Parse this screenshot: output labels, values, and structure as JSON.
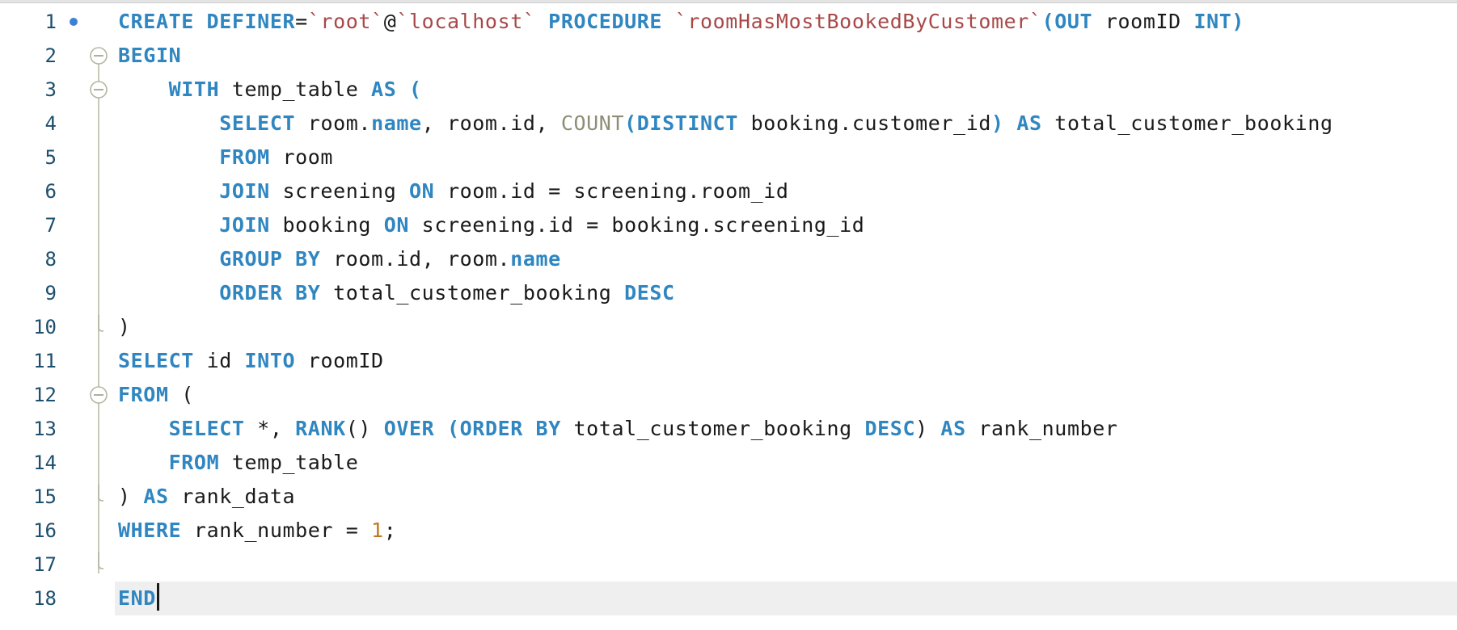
{
  "editor": {
    "language": "sql",
    "caret_line": 18,
    "modified_marker_line": 1,
    "colors": {
      "keyword": "#2f86c0",
      "string": "#a94848",
      "function": "#8e8e76",
      "number": "#c07820",
      "text": "#1a1a1a",
      "gutter": "#1d4f6e",
      "current_line": "#efefef",
      "marker": "#3b82d6"
    },
    "fold_markers": [
      {
        "line": 2,
        "type": "collapse"
      },
      {
        "line": 3,
        "type": "collapse"
      },
      {
        "line": 10,
        "type": "end"
      },
      {
        "line": 12,
        "type": "collapse"
      },
      {
        "line": 15,
        "type": "end"
      },
      {
        "line": 17,
        "type": "end"
      }
    ],
    "lines": [
      {
        "n": "1",
        "tokens": [
          {
            "t": "CREATE DEFINER",
            "c": "kw"
          },
          {
            "t": "=",
            "c": "sym"
          },
          {
            "t": "`root`",
            "c": "str"
          },
          {
            "t": "@",
            "c": "sym"
          },
          {
            "t": "`localhost`",
            "c": "str"
          },
          {
            "t": " PROCEDURE ",
            "c": "kw"
          },
          {
            "t": "`roomHasMostBookedByCustomer`",
            "c": "str"
          },
          {
            "t": "(",
            "c": "kw"
          },
          {
            "t": "OUT",
            "c": "kw"
          },
          {
            "t": " roomID ",
            "c": "plain"
          },
          {
            "t": "INT",
            "c": "kw"
          },
          {
            "t": ")",
            "c": "kw"
          }
        ]
      },
      {
        "n": "2",
        "tokens": [
          {
            "t": "BEGIN",
            "c": "kw"
          }
        ]
      },
      {
        "n": "3",
        "tokens": [
          {
            "t": "    ",
            "c": "plain"
          },
          {
            "t": "WITH",
            "c": "kw"
          },
          {
            "t": " temp_table ",
            "c": "plain"
          },
          {
            "t": "AS",
            "c": "kw"
          },
          {
            "t": " (",
            "c": "kw"
          }
        ]
      },
      {
        "n": "4",
        "tokens": [
          {
            "t": "        ",
            "c": "plain"
          },
          {
            "t": "SELECT",
            "c": "kw"
          },
          {
            "t": " room.",
            "c": "plain"
          },
          {
            "t": "name",
            "c": "prop"
          },
          {
            "t": ", room.id, ",
            "c": "plain"
          },
          {
            "t": "COUNT",
            "c": "fn"
          },
          {
            "t": "(",
            "c": "kw"
          },
          {
            "t": "DISTINCT",
            "c": "kw"
          },
          {
            "t": " booking.customer_id",
            "c": "plain"
          },
          {
            "t": ") ",
            "c": "kw"
          },
          {
            "t": "AS",
            "c": "kw"
          },
          {
            "t": " total_customer_booking",
            "c": "plain"
          }
        ]
      },
      {
        "n": "5",
        "tokens": [
          {
            "t": "        ",
            "c": "plain"
          },
          {
            "t": "FROM",
            "c": "kw"
          },
          {
            "t": " room",
            "c": "plain"
          }
        ]
      },
      {
        "n": "6",
        "tokens": [
          {
            "t": "        ",
            "c": "plain"
          },
          {
            "t": "JOIN",
            "c": "kw"
          },
          {
            "t": " screening ",
            "c": "plain"
          },
          {
            "t": "ON",
            "c": "kw"
          },
          {
            "t": " room.id = screening.room_id",
            "c": "plain"
          }
        ]
      },
      {
        "n": "7",
        "tokens": [
          {
            "t": "        ",
            "c": "plain"
          },
          {
            "t": "JOIN",
            "c": "kw"
          },
          {
            "t": " booking ",
            "c": "plain"
          },
          {
            "t": "ON",
            "c": "kw"
          },
          {
            "t": " screening.id = booking.screening_id",
            "c": "plain"
          }
        ]
      },
      {
        "n": "8",
        "tokens": [
          {
            "t": "        ",
            "c": "plain"
          },
          {
            "t": "GROUP BY",
            "c": "kw"
          },
          {
            "t": " room.id, room.",
            "c": "plain"
          },
          {
            "t": "name",
            "c": "prop"
          }
        ]
      },
      {
        "n": "9",
        "tokens": [
          {
            "t": "        ",
            "c": "plain"
          },
          {
            "t": "ORDER BY",
            "c": "kw"
          },
          {
            "t": " total_customer_booking ",
            "c": "plain"
          },
          {
            "t": "DESC",
            "c": "kw"
          }
        ]
      },
      {
        "n": "10",
        "tokens": [
          {
            "t": ")",
            "c": "plain"
          }
        ]
      },
      {
        "n": "11",
        "tokens": [
          {
            "t": "SELECT",
            "c": "kw"
          },
          {
            "t": " id ",
            "c": "plain"
          },
          {
            "t": "INTO",
            "c": "kw"
          },
          {
            "t": " roomID",
            "c": "plain"
          }
        ]
      },
      {
        "n": "12",
        "tokens": [
          {
            "t": "FROM",
            "c": "kw"
          },
          {
            "t": " (",
            "c": "plain"
          }
        ]
      },
      {
        "n": "13",
        "tokens": [
          {
            "t": "    ",
            "c": "plain"
          },
          {
            "t": "SELECT",
            "c": "kw"
          },
          {
            "t": " *, ",
            "c": "plain"
          },
          {
            "t": "RANK",
            "c": "kw"
          },
          {
            "t": "() ",
            "c": "plain"
          },
          {
            "t": "OVER",
            "c": "kw"
          },
          {
            "t": " (",
            "c": "kw"
          },
          {
            "t": "ORDER BY",
            "c": "kw"
          },
          {
            "t": " total_customer_booking ",
            "c": "plain"
          },
          {
            "t": "DESC",
            "c": "kw"
          },
          {
            "t": ") ",
            "c": "plain"
          },
          {
            "t": "AS",
            "c": "kw"
          },
          {
            "t": " rank_number",
            "c": "plain"
          }
        ]
      },
      {
        "n": "14",
        "tokens": [
          {
            "t": "    ",
            "c": "plain"
          },
          {
            "t": "FROM",
            "c": "kw"
          },
          {
            "t": " temp_table",
            "c": "plain"
          }
        ]
      },
      {
        "n": "15",
        "tokens": [
          {
            "t": ") ",
            "c": "plain"
          },
          {
            "t": "AS",
            "c": "kw"
          },
          {
            "t": " rank_data",
            "c": "plain"
          }
        ]
      },
      {
        "n": "16",
        "tokens": [
          {
            "t": "WHERE",
            "c": "kw"
          },
          {
            "t": " rank_number = ",
            "c": "plain"
          },
          {
            "t": "1",
            "c": "num"
          },
          {
            "t": ";",
            "c": "plain"
          }
        ]
      },
      {
        "n": "17",
        "tokens": []
      },
      {
        "n": "18",
        "tokens": [
          {
            "t": "END",
            "c": "kw"
          }
        ]
      }
    ]
  }
}
